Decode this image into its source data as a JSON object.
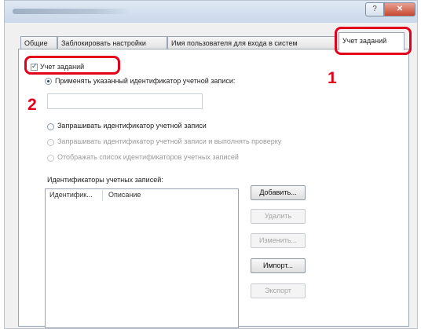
{
  "window": {
    "help_glyph": "?",
    "close_glyph": "✕"
  },
  "tabs": [
    {
      "label": "Общие"
    },
    {
      "label": "Заблокировать настройки"
    },
    {
      "label": "Имя пользователя для входа в систем"
    },
    {
      "label": "Учет заданий"
    }
  ],
  "job_accounting_checkbox": {
    "label": "Учет заданий",
    "checked": true
  },
  "options": {
    "apply_id": {
      "label": "Применять указанный идентификатор учетной записи:",
      "selected": true
    },
    "prompt_id": {
      "label": "Запрашивать идентификатор учетной записи",
      "selected": false
    },
    "prompt_verify": {
      "label": "Запрашивать идентификатор учетной записи и выполнять проверку",
      "selected": false,
      "enabled": false
    },
    "show_list": {
      "label": "Отображать список идентификаторов учетных записей",
      "selected": false,
      "enabled": false
    }
  },
  "account_id_value": "",
  "ids_list": {
    "label": "Идентификаторы учетных записей:",
    "columns": [
      "Идентифик...",
      "Описание"
    ],
    "rows": []
  },
  "buttons": {
    "add": "Добавить...",
    "delete": "Удалить",
    "edit": "Изменить...",
    "import": "Импорт...",
    "export": "Экспорт"
  },
  "callouts": {
    "one": "1",
    "two": "2"
  },
  "colors": {
    "callout": "#e3001b"
  }
}
